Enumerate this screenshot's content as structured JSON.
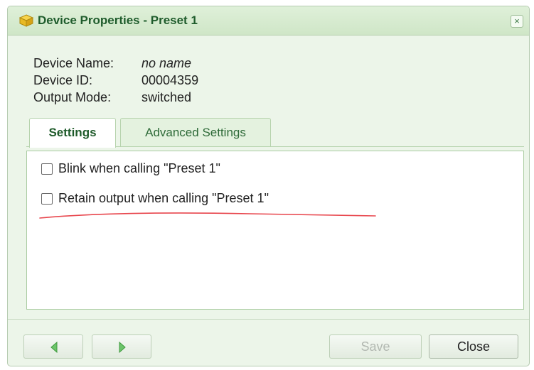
{
  "dialog": {
    "title": "Device Properties - Preset 1",
    "close_glyph": "×",
    "title_icon": "device-cube-icon"
  },
  "info": {
    "name_label": "Device Name:",
    "name_value": "no name",
    "id_label": "Device ID:",
    "id_value": "00004359",
    "mode_label": "Output Mode:",
    "mode_value": "switched"
  },
  "tabs": [
    {
      "label": "Settings",
      "active": true
    },
    {
      "label": "Advanced Settings",
      "active": false
    }
  ],
  "settings": {
    "options": [
      {
        "label": "Blink when calling \"Preset 1\"",
        "checked": false
      },
      {
        "label": "Retain output when calling \"Preset 1\"",
        "checked": false
      }
    ]
  },
  "footer": {
    "prev_icon": "triangle-left-icon",
    "next_icon": "triangle-right-icon",
    "save_label": "Save",
    "close_label": "Close"
  },
  "colors": {
    "accent": "#1f5c2c",
    "annotation_underline": "#e8474e",
    "arrow": "#6cc46a"
  }
}
